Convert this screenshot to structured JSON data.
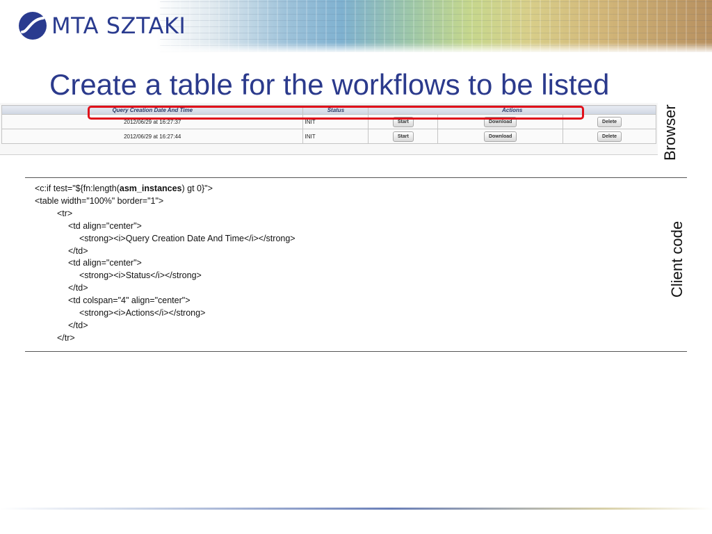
{
  "header": {
    "logo_text": "MTA SZTAKI"
  },
  "title": "Create a table for the workflows to be listed",
  "browser_table": {
    "headers": [
      "Query Creation Date And Time",
      "Status",
      "Actions"
    ],
    "rows": [
      {
        "date": "2012/06/29 at 16:27:37",
        "status": "INIT",
        "actions": [
          "Start",
          "Download",
          "Delete"
        ]
      },
      {
        "date": "2012/06/29 at 16:27:44",
        "status": "INIT",
        "actions": [
          "Start",
          "Download",
          "Delete"
        ]
      }
    ]
  },
  "side_labels": {
    "browser": "Browser",
    "client_code": "Client code"
  },
  "code": {
    "line1_pre": "<c:if test=\"${fn:length(",
    "line1_bold": "asm_instances",
    "line1_post": ") gt 0}\">",
    "lines": [
      "<table width=\"100%\" border=\"1\">",
      "<tr>",
      "<td align=\"center\">",
      "<strong><i>Query Creation Date And Time</i></strong>",
      "</td>",
      "<td align=\"center\">",
      "<strong><i>Status</i></strong>",
      "</td>",
      "<td colspan=\"4\" align=\"center\">",
      "<strong><i>Actions</i></strong>",
      "</td>",
      "</tr>"
    ]
  },
  "colors": {
    "title": "#2b3a8c",
    "highlight": "#e0101a"
  }
}
